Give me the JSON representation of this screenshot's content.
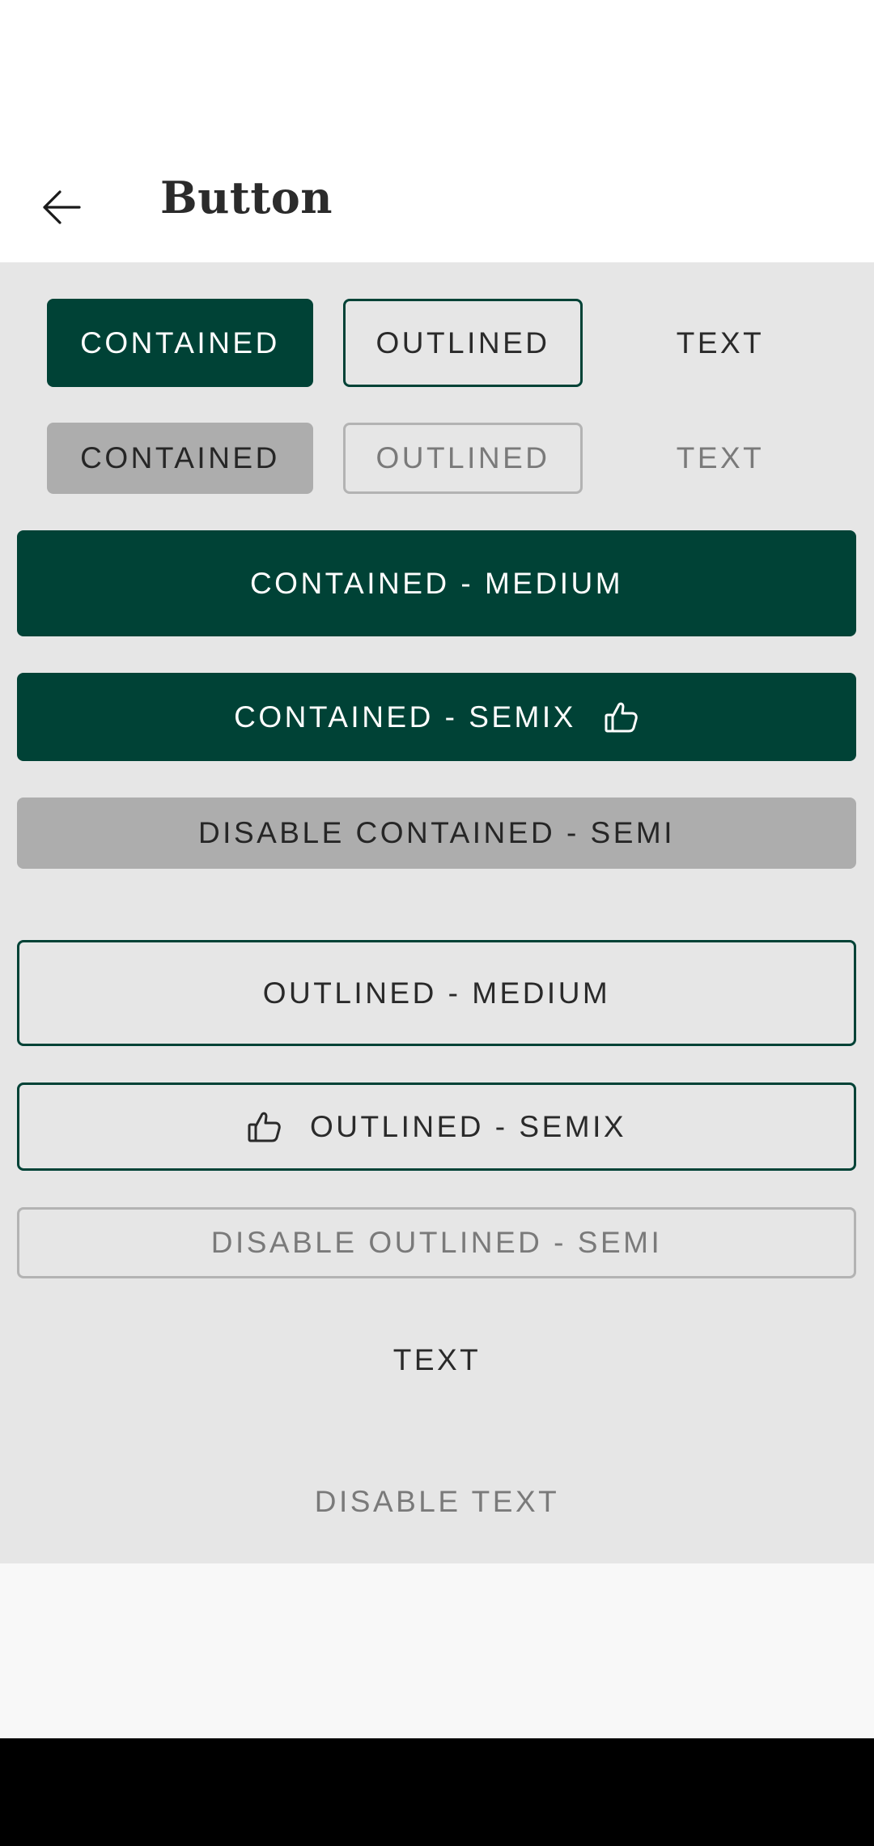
{
  "header": {
    "title": "Button",
    "back_icon": "arrow-back-icon"
  },
  "buttons": {
    "row1": {
      "contained": "CONTAINED",
      "outlined": "OUTLINED",
      "text": "TEXT"
    },
    "row2_disabled": {
      "contained": "CONTAINED",
      "outlined": "OUTLINED",
      "text": "TEXT"
    },
    "contained_medium": "CONTAINED - MEDIUM",
    "contained_semix": "CONTAINED - SEMIX",
    "disable_contained_semi": "DISABLE CONTAINED - SEMI",
    "outlined_medium": "OUTLINED - MEDIUM",
    "outlined_semix": "OUTLINED - SEMIX",
    "disable_outlined_semi": "DISABLE OUTLINED - SEMI",
    "text": "TEXT",
    "disable_text": "DISABLE TEXT"
  },
  "icons": {
    "thumbs_up": "thumbs-up-icon"
  },
  "colors": {
    "primary": "#004236",
    "content_background": "#e6e6e6",
    "disabled_fill": "#adadad",
    "disabled_text": "#7a7a7a"
  }
}
